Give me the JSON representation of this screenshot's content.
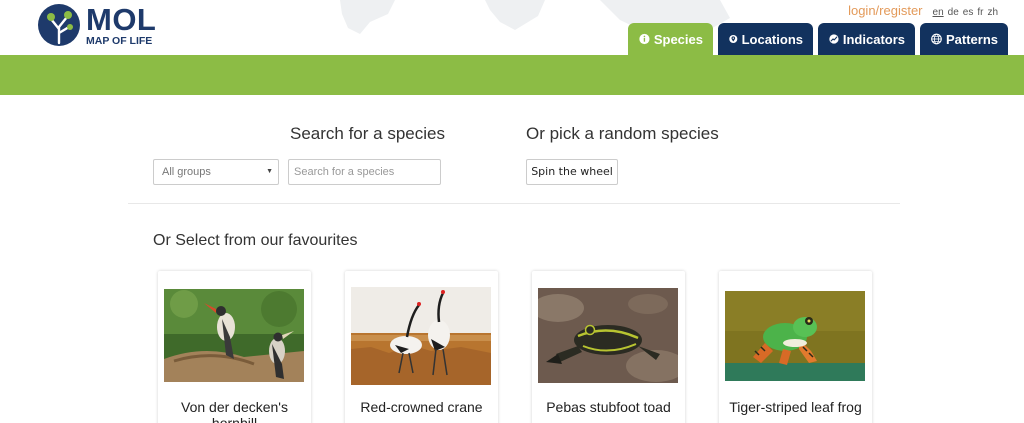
{
  "header": {
    "logo": {
      "title": "MOL",
      "subtitle": "MAP OF LIFE"
    },
    "login_label": "login/register",
    "languages": [
      "en",
      "de",
      "es",
      "fr",
      "zh"
    ],
    "active_language": "en",
    "tabs": [
      {
        "label": "Species",
        "icon": "info-icon",
        "active": true
      },
      {
        "label": "Locations",
        "icon": "map-pin-icon",
        "active": false
      },
      {
        "label": "Indicators",
        "icon": "trend-chart-icon",
        "active": false
      },
      {
        "label": "Patterns",
        "icon": "globe-icon",
        "active": false
      }
    ]
  },
  "colors": {
    "accent_green": "#8cbc45",
    "nav_blue": "#12325e",
    "login_orange": "#e39a5a"
  },
  "search": {
    "heading": "Search for a species",
    "group_select": {
      "value": "All groups"
    },
    "input_placeholder": "Search for a species"
  },
  "random": {
    "heading": "Or pick a random species",
    "button_label": "Spin the wheel"
  },
  "favourites": {
    "heading": "Or Select from our favourites",
    "items": [
      {
        "name": "Von der decken's hornbill"
      },
      {
        "name": "Red-crowned crane"
      },
      {
        "name": "Pebas stubfoot toad"
      },
      {
        "name": "Tiger-striped leaf frog"
      }
    ]
  }
}
